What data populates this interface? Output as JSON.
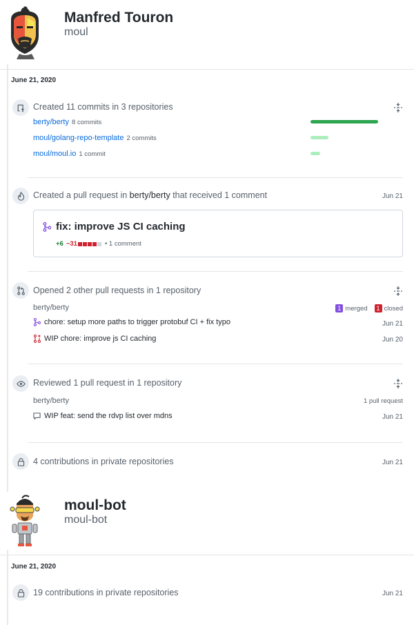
{
  "users": [
    {
      "name": "Manfred Touron",
      "login": "moul",
      "date": "June 21, 2020",
      "commits_event": {
        "title": "Created 11 commits in 3 repositories",
        "repos": [
          {
            "name": "berty/berty",
            "count": "8 commits",
            "share": 8
          },
          {
            "name": "moul/golang-repo-template",
            "count": "2 commits",
            "share": 2
          },
          {
            "name": "moul/moul.io",
            "count": "1 commit",
            "share": 1
          }
        ]
      },
      "pr_event": {
        "title_prefix": "Created a pull request in ",
        "title_repo": "berty/berty",
        "title_suffix": " that received 1 comment",
        "date": "Jun 21",
        "pr_title": "fix: improve JS CI caching",
        "additions": "+6",
        "deletions": "−31",
        "comments": "• 1 comment",
        "diff_blocks": [
          "del",
          "del",
          "del",
          "del",
          "neutral"
        ]
      },
      "opened_event": {
        "title": "Opened 2 other pull requests in 1 repository",
        "repo": "berty/berty",
        "merged_count": "1",
        "merged_label": "merged",
        "closed_count": "1",
        "closed_label": "closed",
        "prs": [
          {
            "title": "chore: setup more paths to trigger protobuf CI + fix typo",
            "date": "Jun 21",
            "state": "merged"
          },
          {
            "title": "WIP chore: improve js CI caching",
            "date": "Jun 20",
            "state": "closed"
          }
        ]
      },
      "review_event": {
        "title": "Reviewed 1 pull request in 1 repository",
        "repo": "berty/berty",
        "right_label": "1 pull request",
        "item": "WIP feat: send the rdvp list over mdns",
        "date": "Jun 21"
      },
      "private_event": {
        "title": "4 contributions in private repositories",
        "date": "Jun 21"
      }
    },
    {
      "name": "moul-bot",
      "login": "moul-bot",
      "date": "June 21, 2020",
      "private_event": {
        "title": "19 contributions in private repositories",
        "date": "Jun 21"
      }
    }
  ],
  "colors": {
    "link": "#0969da",
    "bar_primary": "#2da44e",
    "bar_light": "#aceebb",
    "merged": "#8250df",
    "closed": "#cf222e",
    "added": "#1a7f37",
    "neutral_block": "#d0d7de"
  },
  "icons": {
    "commit": "repo-push-icon",
    "pr_created": "flame-icon",
    "pr_opened": "git-pull-request-icon",
    "review": "eye-icon",
    "private": "lock-icon",
    "fold": "fold-icon",
    "merged": "git-merge-icon",
    "closed": "git-pull-request-closed-icon",
    "comment": "comment-icon"
  }
}
